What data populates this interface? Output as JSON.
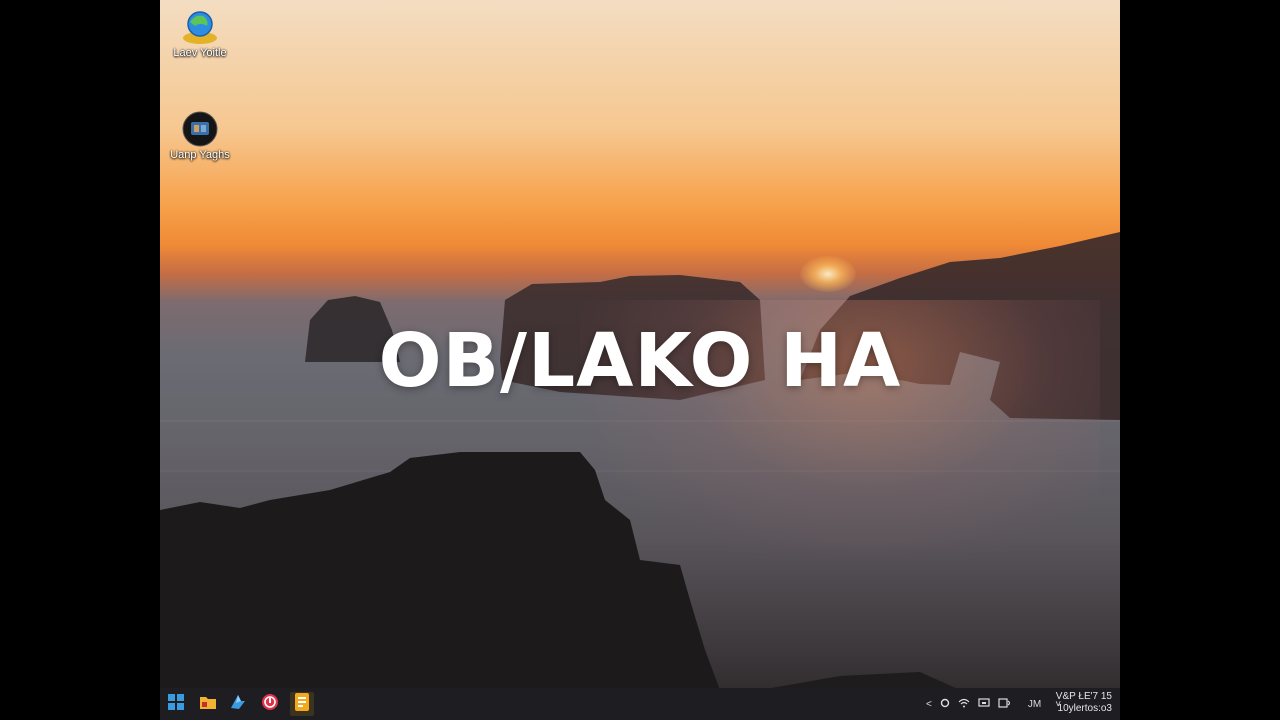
{
  "desktop": {
    "icons": [
      {
        "label": "Laev Yoitle",
        "icon": "browser-globe-icon"
      },
      {
        "label": "Uanp Yaghs",
        "icon": "media-app-icon"
      }
    ],
    "headline": "OB/LAKO HA"
  },
  "taskbar": {
    "pinned": [
      {
        "icon": "windows-start-icon"
      },
      {
        "icon": "file-explorer-icon"
      },
      {
        "icon": "app-blue-icon"
      },
      {
        "icon": "app-red-icon"
      },
      {
        "icon": "document-app-icon"
      }
    ],
    "tray": {
      "chevron": "<",
      "language": "JM",
      "caret": "˅"
    },
    "clock": {
      "time": "V&P ŁE'7 15",
      "date": "10ylertos:o3"
    }
  },
  "colors": {
    "taskbar_bg": "#1d1d22",
    "start_blue": "#3a9be0",
    "explorer_yellow": "#f2b233"
  }
}
